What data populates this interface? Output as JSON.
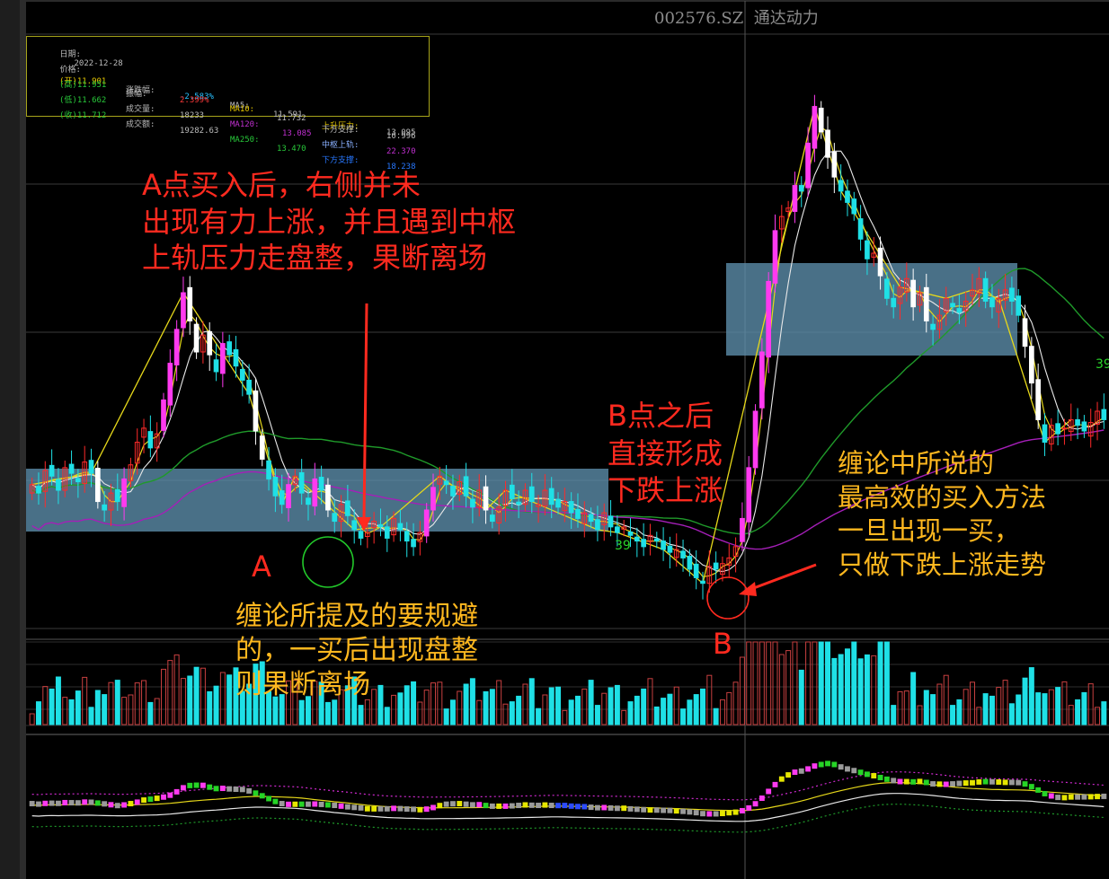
{
  "header": {
    "title": "002576.SZ  通达动力"
  },
  "info_panel": {
    "date_label": "日期:",
    "date_value": "2022-12-28",
    "price_label": "价格:",
    "open": "(开)11.901",
    "high": "(高)11.951",
    "low": "(低)11.662",
    "close": "(收)11.712",
    "change_pct_label": "涨跌幅:",
    "change_pct": "-2.583%",
    "amplitude_label": "振幅:",
    "amplitude": "2.399%",
    "volume_label": "成交量:",
    "volume": "18233",
    "amount_label": "成交额:",
    "amount": "19282.63",
    "ma5_label": "MA5:",
    "ma5": "11.591",
    "ma10_label": "MA10:",
    "ma10": "11.732",
    "ma120_label": "MA120:",
    "ma120": "13.085",
    "ma250_label": "MA250:",
    "ma250": "13.470",
    "resist_label": "上升压力:",
    "resist": "13.095",
    "support_label": "下方支撑:",
    "support": "10.996",
    "upper_label": "中枢上轨:",
    "upper": "22.370",
    "lower_label": "下方支撑:",
    "lower": "18.238"
  },
  "annotations": {
    "note_a": "A点买入后，右侧并未\n出现有力上涨，并且遇到中枢\n上轨压力走盘整，果断离场",
    "note_b": "B点之后\n直接形成\n下跌上涨",
    "note_avoid": "缠论所提及的要规避\n的，一买后出现盘整\n则果断离场",
    "note_best": "缠论中所说的\n最高效的买入方法\n一旦出现一买，\n只做下跌上涨走势",
    "label_a": "A",
    "label_b": "B",
    "mark_39_left": "39",
    "mark_39_right": "39"
  },
  "colors": {
    "up_candle": "#ff2a2a",
    "down_candle": "#1fe0e6",
    "zone_fill": "#5d8fad",
    "ma_yellow": "#e6d81a",
    "ma_white": "#e8e8e8",
    "ma_green": "#1f9a2a",
    "ma_purple": "#a51fb8",
    "annot_red": "#ff2a1f",
    "annot_yellow": "#ffb81f",
    "grid": "#3a3a3a"
  },
  "chart_data": {
    "type": "candlestick",
    "symbol": "002576.SZ",
    "name": "通达动力",
    "date": "2022-12-28",
    "open": 11.901,
    "high": 11.951,
    "low": 11.662,
    "close": 11.712,
    "change_pct": -2.583,
    "amplitude_pct": 2.399,
    "volume": 18233,
    "amount": 19282.63,
    "ma": {
      "MA5": 11.591,
      "MA10": 11.732,
      "MA120": 13.085,
      "MA250": 13.47
    },
    "levels": {
      "上升压力": 13.095,
      "下方支撑": 10.996,
      "中枢上轨": 22.37,
      "下方支撑2": 18.238
    },
    "price_ylim": [
      9.5,
      30.5
    ],
    "closes": [
      14.6,
      14.3,
      15.1,
      14.9,
      14.4,
      15.2,
      15.0,
      14.7,
      15.4,
      15.0,
      14.0,
      13.7,
      14.3,
      14.0,
      14.8,
      15.3,
      16.1,
      16.6,
      15.9,
      16.4,
      17.6,
      18.9,
      20.1,
      21.4,
      20.4,
      19.3,
      19.9,
      19.2,
      18.6,
      19.6,
      19.2,
      18.8,
      18.3,
      17.8,
      16.5,
      15.5,
      14.8,
      14.2,
      13.9,
      14.6,
      14.9,
      14.3,
      13.9,
      14.8,
      14.4,
      13.7,
      13.3,
      13.9,
      13.5,
      13.0,
      12.7,
      12.9,
      13.3,
      13.1,
      12.7,
      13.4,
      13.0,
      12.6,
      12.4,
      12.9,
      13.7,
      14.5,
      14.9,
      14.6,
      14.2,
      14.7,
      14.2,
      13.8,
      14.4,
      13.7,
      13.3,
      13.8,
      14.4,
      14.1,
      13.9,
      14.4,
      14.0,
      13.9,
      14.4,
      13.9,
      13.8,
      14.0,
      13.6,
      13.4,
      13.6,
      13.3,
      13.0,
      13.6,
      13.1,
      12.9,
      13.1,
      12.8,
      12.6,
      12.4,
      12.8,
      12.6,
      12.3,
      12.2,
      12.3,
      12.0,
      11.6,
      11.3,
      11.1,
      11.7,
      11.6,
      11.8,
      12.0,
      12.4,
      13.4,
      15.2,
      17.2,
      19.3,
      21.8,
      23.6,
      24.1,
      24.4,
      25.2,
      25.0,
      26.7,
      28.0,
      27.1,
      26.2,
      25.5,
      25.0,
      24.6,
      24.2,
      23.3,
      22.6,
      22.8,
      22.0,
      21.2,
      20.9,
      21.6,
      21.9,
      20.9,
      21.4,
      20.4,
      20.1,
      20.6,
      21.2,
      20.9,
      20.7,
      21.1,
      21.5,
      21.9,
      21.1,
      20.9,
      21.2,
      21.5,
      21.1,
      20.6,
      19.5,
      18.2,
      16.9,
      16.1,
      16.7,
      16.4,
      16.6,
      16.9,
      16.7,
      16.5,
      16.8,
      17.2,
      16.9
    ]
  }
}
